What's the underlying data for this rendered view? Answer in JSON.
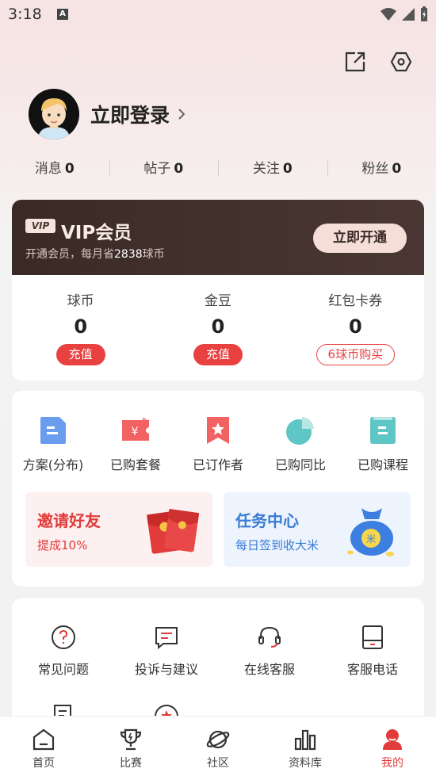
{
  "status_bar": {
    "time": "3:18",
    "notif_letter": "A"
  },
  "profile": {
    "login_label": "立即登录"
  },
  "stats": [
    {
      "label": "消息",
      "value": "0"
    },
    {
      "label": "帖子",
      "value": "0"
    },
    {
      "label": "关注",
      "value": "0"
    },
    {
      "label": "粉丝",
      "value": "0"
    }
  ],
  "vip": {
    "badge": "VIP",
    "title": "VIP会员",
    "subtitle_prefix": "开通会员，每月省",
    "subtitle_amount": "2838",
    "subtitle_suffix": "球币",
    "button": "立即开通"
  },
  "wallet": [
    {
      "label": "球币",
      "value": "0",
      "action": "充值"
    },
    {
      "label": "金豆",
      "value": "0",
      "action": "充值"
    },
    {
      "label": "红包卡券",
      "value": "0",
      "action": "6球币购买"
    }
  ],
  "services": [
    {
      "label": "方案(分布)",
      "icon": "doc-blue-icon",
      "color": "#6a9cf0"
    },
    {
      "label": "已购套餐",
      "icon": "ticket-yen-icon",
      "color": "#f26262"
    },
    {
      "label": "已订作者",
      "icon": "bookmark-star-icon",
      "color": "#f26262"
    },
    {
      "label": "已购同比",
      "icon": "pie-icon",
      "color": "#5ec6c4"
    },
    {
      "label": "已购课程",
      "icon": "book-icon",
      "color": "#5ec6c4"
    }
  ],
  "promos": {
    "invite": {
      "title": "邀请好友",
      "subtitle": "提成10%"
    },
    "task": {
      "title": "任务中心",
      "subtitle": "每日签到收大米",
      "bag_text": "米"
    }
  },
  "help": [
    {
      "label": "常见问题",
      "icon": "question-icon"
    },
    {
      "label": "投诉与建议",
      "icon": "message-icon"
    },
    {
      "label": "在线客服",
      "icon": "headset-icon"
    },
    {
      "label": "客服电话",
      "icon": "phone-icon"
    },
    {
      "label": "",
      "icon": "edit-doc-icon"
    },
    {
      "label": "",
      "icon": "star-circle-icon"
    }
  ],
  "tabs": [
    {
      "label": "首页",
      "icon": "home-icon"
    },
    {
      "label": "比赛",
      "icon": "trophy-icon"
    },
    {
      "label": "社区",
      "icon": "planet-icon"
    },
    {
      "label": "资料库",
      "icon": "bar-chart-icon"
    },
    {
      "label": "我的",
      "icon": "user-icon",
      "active": true
    }
  ],
  "colors": {
    "accent": "#e23b3b",
    "vip_dark": "#3a2a26",
    "blue": "#3a7bd5"
  }
}
